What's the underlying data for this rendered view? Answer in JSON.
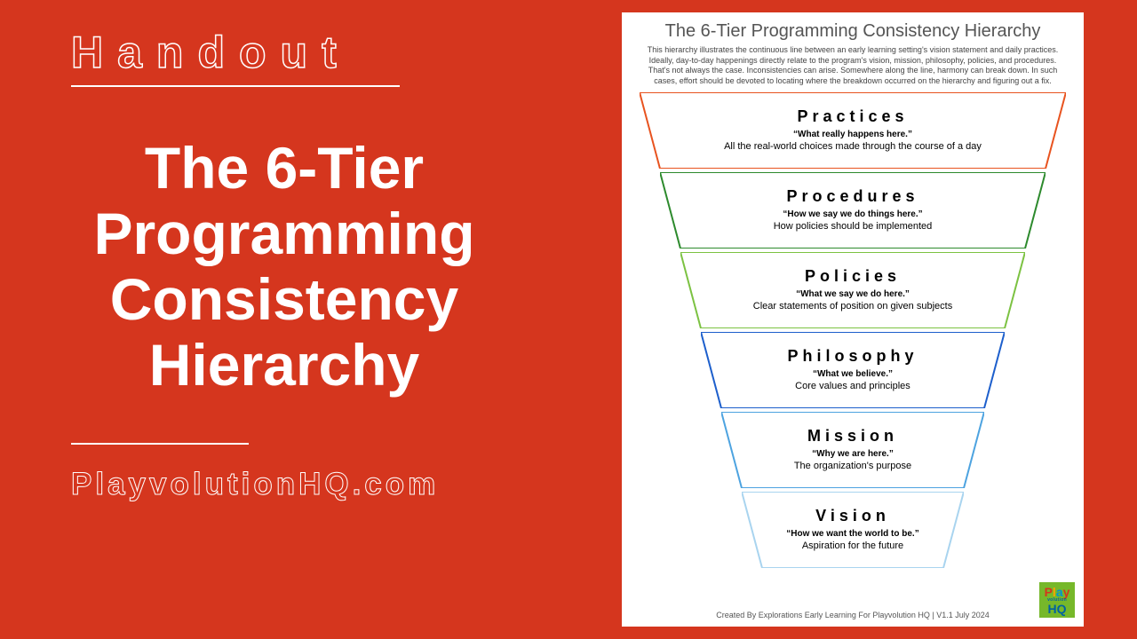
{
  "left": {
    "label": "Handout",
    "title": "The 6-Tier Programming Consistency Hierarchy",
    "url": "PlayvolutionHQ.com"
  },
  "card": {
    "title": "The 6-Tier Programming Consistency Hierarchy",
    "intro": "This hierarchy illustrates the continuous line between an early learning setting's vision statement and daily practices. Ideally, day-to-day happenings directly relate to the program's vision, mission, philosophy, policies, and procedures. That's not always the case. Inconsistencies can arise. Somewhere along the line, harmony can break down. In such cases, effort should be devoted to locating where the breakdown occurred on the hierarchy and figuring out a fix.",
    "tiers": [
      {
        "name": "Practices",
        "quote": "“What really happens here.”",
        "desc": "All the real-world choices made through the course of a day",
        "color": "#e8531f",
        "topW": 480,
        "botW": 434
      },
      {
        "name": "Procedures",
        "quote": "“How we say we do things here.”",
        "desc": "How policies should be implemented",
        "color": "#2d8a2d",
        "topW": 434,
        "botW": 388
      },
      {
        "name": "Policies",
        "quote": "“What we say we do here.”",
        "desc": "Clear statements of position on given subjects",
        "color": "#7cc242",
        "topW": 388,
        "botW": 342
      },
      {
        "name": "Philosophy",
        "quote": "“What we believe.”",
        "desc": "Core values and principles",
        "color": "#1d5fcc",
        "topW": 342,
        "botW": 296
      },
      {
        "name": "Mission",
        "quote": "“Why we are here.”",
        "desc": "The organization's purpose",
        "color": "#4da3e0",
        "topW": 296,
        "botW": 250
      },
      {
        "name": "Vision",
        "quote": "“How we want the world to be.”",
        "desc": "Aspiration for the future",
        "color": "#a9d4ef",
        "topW": 250,
        "botW": 204
      }
    ],
    "footer": "Created By Explorations Early Learning For Playvolution HQ | V1.1 July 2024",
    "logo": {
      "brand_top": "Play",
      "brand_sub": "volution",
      "brand_bottom": "HQ"
    }
  },
  "chart_data": {
    "type": "funnel-hierarchy",
    "title": "The 6-Tier Programming Consistency Hierarchy",
    "direction": "top-to-bottom (broadest at top, narrowest at bottom)",
    "levels": [
      {
        "order": 1,
        "name": "Practices",
        "tagline": "What really happens here.",
        "definition": "All the real-world choices made through the course of a day"
      },
      {
        "order": 2,
        "name": "Procedures",
        "tagline": "How we say we do things here.",
        "definition": "How policies should be implemented"
      },
      {
        "order": 3,
        "name": "Policies",
        "tagline": "What we say we do here.",
        "definition": "Clear statements of position on given subjects"
      },
      {
        "order": 4,
        "name": "Philosophy",
        "tagline": "What we believe.",
        "definition": "Core values and principles"
      },
      {
        "order": 5,
        "name": "Mission",
        "tagline": "Why we are here.",
        "definition": "The organization's purpose"
      },
      {
        "order": 6,
        "name": "Vision",
        "tagline": "How we want the world to be.",
        "definition": "Aspiration for the future"
      }
    ]
  }
}
